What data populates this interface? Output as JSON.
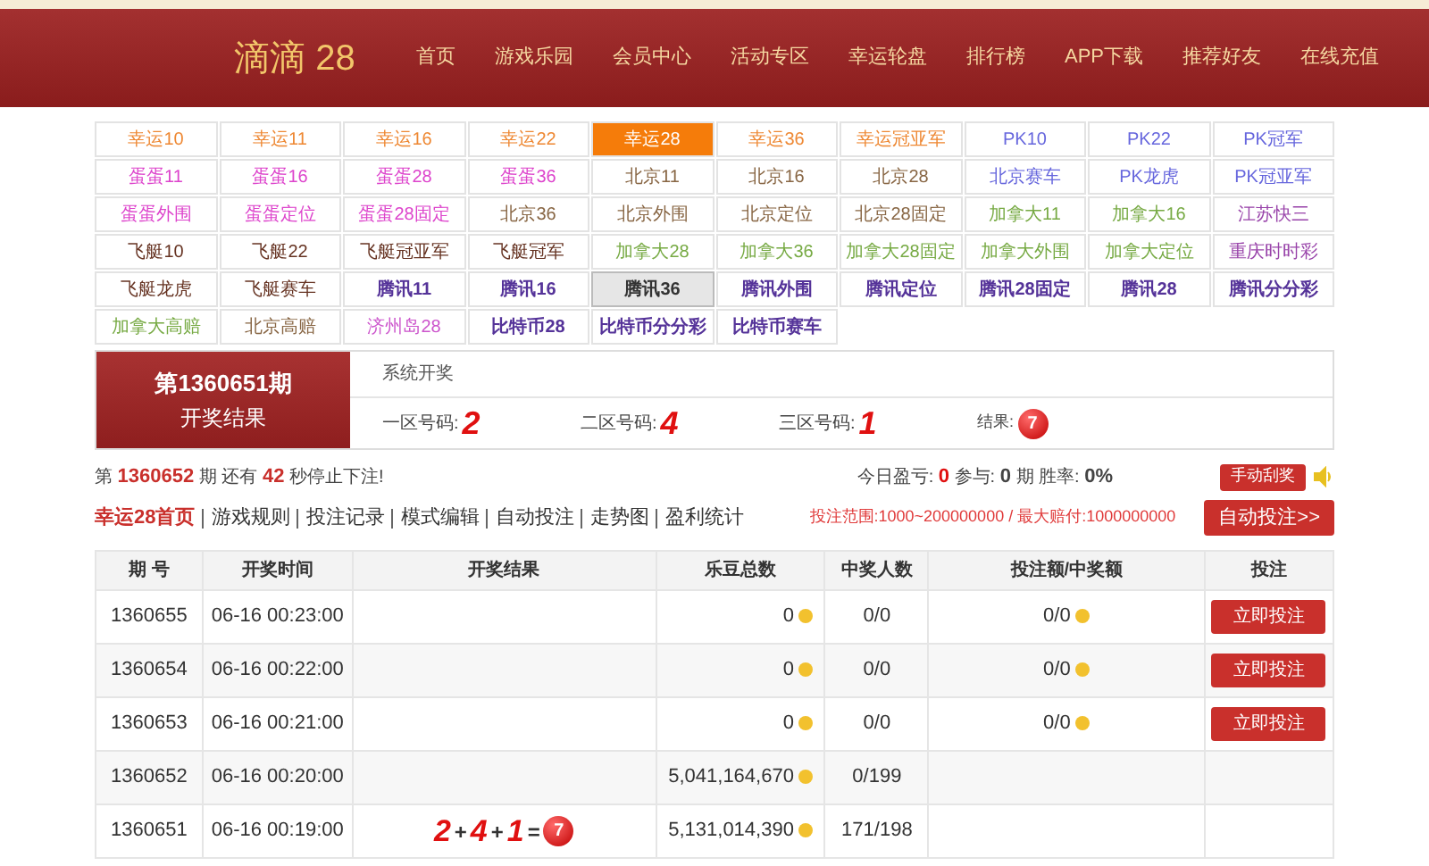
{
  "header": {
    "logo": "滴滴 28",
    "nav": [
      "首页",
      "游戏乐园",
      "会员中心",
      "活动专区",
      "幸运轮盘",
      "排行榜",
      "APP下载",
      "推荐好友",
      "在线充值"
    ]
  },
  "games": [
    {
      "label": "幸运10",
      "color": "#ee8833",
      "bold": false,
      "selected": false,
      "highlighted": false
    },
    {
      "label": "幸运11",
      "color": "#ee8833",
      "bold": false,
      "selected": false,
      "highlighted": false
    },
    {
      "label": "幸运16",
      "color": "#ee8833",
      "bold": false,
      "selected": false,
      "highlighted": false
    },
    {
      "label": "幸运22",
      "color": "#ee8833",
      "bold": false,
      "selected": false,
      "highlighted": false
    },
    {
      "label": "幸运28",
      "bold": false,
      "selected": true,
      "highlighted": false
    },
    {
      "label": "幸运36",
      "color": "#ee8833",
      "bold": false,
      "selected": false,
      "highlighted": false
    },
    {
      "label": "幸运冠亚军",
      "color": "#ee8833",
      "bold": false,
      "selected": false,
      "highlighted": false
    },
    {
      "label": "PK10",
      "color": "#6666dd",
      "bold": false,
      "selected": false,
      "highlighted": false
    },
    {
      "label": "PK22",
      "color": "#6666dd",
      "bold": false,
      "selected": false,
      "highlighted": false
    },
    {
      "label": "PK冠军",
      "color": "#6666dd",
      "bold": false,
      "selected": false,
      "highlighted": false
    },
    {
      "label": "蛋蛋11",
      "color": "#dd44cc",
      "bold": false,
      "selected": false,
      "highlighted": false
    },
    {
      "label": "蛋蛋16",
      "color": "#dd44cc",
      "bold": false,
      "selected": false,
      "highlighted": false
    },
    {
      "label": "蛋蛋28",
      "color": "#dd44cc",
      "bold": false,
      "selected": false,
      "highlighted": false
    },
    {
      "label": "蛋蛋36",
      "color": "#dd44cc",
      "bold": false,
      "selected": false,
      "highlighted": false
    },
    {
      "label": "北京11",
      "color": "#886644",
      "bold": false,
      "selected": false,
      "highlighted": false
    },
    {
      "label": "北京16",
      "color": "#886644",
      "bold": false,
      "selected": false,
      "highlighted": false
    },
    {
      "label": "北京28",
      "color": "#886644",
      "bold": false,
      "selected": false,
      "highlighted": false
    },
    {
      "label": "北京赛车",
      "color": "#6666dd",
      "bold": false,
      "selected": false,
      "highlighted": false
    },
    {
      "label": "PK龙虎",
      "color": "#6666dd",
      "bold": false,
      "selected": false,
      "highlighted": false
    },
    {
      "label": "PK冠亚军",
      "color": "#6666dd",
      "bold": false,
      "selected": false,
      "highlighted": false
    },
    {
      "label": "蛋蛋外围",
      "color": "#dd44cc",
      "bold": false,
      "selected": false,
      "highlighted": false
    },
    {
      "label": "蛋蛋定位",
      "color": "#dd44cc",
      "bold": false,
      "selected": false,
      "highlighted": false
    },
    {
      "label": "蛋蛋28固定",
      "color": "#dd44cc",
      "bold": false,
      "selected": false,
      "highlighted": false
    },
    {
      "label": "北京36",
      "color": "#886644",
      "bold": false,
      "selected": false,
      "highlighted": false
    },
    {
      "label": "北京外围",
      "color": "#886644",
      "bold": false,
      "selected": false,
      "highlighted": false
    },
    {
      "label": "北京定位",
      "color": "#886644",
      "bold": false,
      "selected": false,
      "highlighted": false
    },
    {
      "label": "北京28固定",
      "color": "#886644",
      "bold": false,
      "selected": false,
      "highlighted": false
    },
    {
      "label": "加拿大11",
      "color": "#77aa44",
      "bold": false,
      "selected": false,
      "highlighted": false
    },
    {
      "label": "加拿大16",
      "color": "#77aa44",
      "bold": false,
      "selected": false,
      "highlighted": false
    },
    {
      "label": "江苏快三",
      "color": "#9944aa",
      "bold": false,
      "selected": false,
      "highlighted": false
    },
    {
      "label": "飞艇10",
      "color": "#663322",
      "bold": false,
      "selected": false,
      "highlighted": false
    },
    {
      "label": "飞艇22",
      "color": "#663322",
      "bold": false,
      "selected": false,
      "highlighted": false
    },
    {
      "label": "飞艇冠亚军",
      "color": "#663322",
      "bold": false,
      "selected": false,
      "highlighted": false
    },
    {
      "label": "飞艇冠军",
      "color": "#663322",
      "bold": false,
      "selected": false,
      "highlighted": false
    },
    {
      "label": "加拿大28",
      "color": "#77aa44",
      "bold": false,
      "selected": false,
      "highlighted": false
    },
    {
      "label": "加拿大36",
      "color": "#77aa44",
      "bold": false,
      "selected": false,
      "highlighted": false
    },
    {
      "label": "加拿大28固定",
      "color": "#77aa44",
      "bold": false,
      "selected": false,
      "highlighted": false
    },
    {
      "label": "加拿大外围",
      "color": "#77aa44",
      "bold": false,
      "selected": false,
      "highlighted": false
    },
    {
      "label": "加拿大定位",
      "color": "#77aa44",
      "bold": false,
      "selected": false,
      "highlighted": false
    },
    {
      "label": "重庆时时彩",
      "color": "#9944aa",
      "bold": false,
      "selected": false,
      "highlighted": false
    },
    {
      "label": "飞艇龙虎",
      "color": "#663322",
      "bold": false,
      "selected": false,
      "highlighted": false
    },
    {
      "label": "飞艇赛车",
      "color": "#663322",
      "bold": false,
      "selected": false,
      "highlighted": false
    },
    {
      "label": "腾讯11",
      "color": "#553399",
      "bold": true,
      "selected": false,
      "highlighted": false
    },
    {
      "label": "腾讯16",
      "color": "#553399",
      "bold": true,
      "selected": false,
      "highlighted": false
    },
    {
      "label": "腾讯36",
      "color": "#333333",
      "bold": true,
      "selected": false,
      "highlighted": true
    },
    {
      "label": "腾讯外围",
      "color": "#553399",
      "bold": true,
      "selected": false,
      "highlighted": false
    },
    {
      "label": "腾讯定位",
      "color": "#553399",
      "bold": true,
      "selected": false,
      "highlighted": false
    },
    {
      "label": "腾讯28固定",
      "color": "#553399",
      "bold": true,
      "selected": false,
      "highlighted": false
    },
    {
      "label": "腾讯28",
      "color": "#553399",
      "bold": true,
      "selected": false,
      "highlighted": false
    },
    {
      "label": "腾讯分分彩",
      "color": "#553399",
      "bold": true,
      "selected": false,
      "highlighted": false
    },
    {
      "label": "加拿大高赔",
      "color": "#77aa44",
      "bold": false,
      "selected": false,
      "highlighted": false
    },
    {
      "label": "北京高赔",
      "color": "#886644",
      "bold": false,
      "selected": false,
      "highlighted": false
    },
    {
      "label": "济州岛28",
      "color": "#cc55cc",
      "bold": false,
      "selected": false,
      "highlighted": false
    },
    {
      "label": "比特币28",
      "color": "#553399",
      "bold": true,
      "selected": false,
      "highlighted": false
    },
    {
      "label": "比特币分分彩",
      "color": "#553399",
      "bold": true,
      "selected": false,
      "highlighted": false
    },
    {
      "label": "比特币赛车",
      "color": "#553399",
      "bold": true,
      "selected": false,
      "highlighted": false
    }
  ],
  "result": {
    "issue": "第1360651期",
    "caption": "开奖结果",
    "mode": "系统开奖",
    "zones": [
      {
        "label": "一区号码:",
        "value": "2"
      },
      {
        "label": "二区号码:",
        "value": "4"
      },
      {
        "label": "三区号码:",
        "value": "1"
      }
    ],
    "total_label": "结果:",
    "total": "7"
  },
  "status": {
    "prefix": "第",
    "issue": "1360652",
    "mid": "期 还有",
    "seconds": "42",
    "suffix": "秒停止下注!",
    "profit_label": "今日盈亏:",
    "profit": "0",
    "join_label": "参与:",
    "join": "0",
    "join_unit": "期 胜率:",
    "rate": "0%",
    "manual_button": "手动刮奖"
  },
  "links": [
    "幸运28首页",
    "游戏规则",
    "投注记录",
    "模式编辑",
    "自动投注",
    "走势图",
    "盈利统计"
  ],
  "bet_range": "投注范围:1000~200000000 / 最大赔付:1000000000",
  "auto_button": "自动投注>>",
  "table": {
    "columns": [
      "期 号",
      "开奖时间",
      "开奖结果",
      "乐豆总数",
      "中奖人数",
      "投注额/中奖额",
      "投注"
    ],
    "rows": [
      {
        "issue": "1360655",
        "time": "06-16 00:23:00",
        "beans": "0",
        "winners": "0/0",
        "bet": "0/0",
        "button": "立即投注"
      },
      {
        "issue": "1360654",
        "time": "06-16 00:22:00",
        "beans": "0",
        "winners": "0/0",
        "bet": "0/0",
        "button": "立即投注"
      },
      {
        "issue": "1360653",
        "time": "06-16 00:21:00",
        "beans": "0",
        "winners": "0/0",
        "bet": "0/0",
        "button": "立即投注"
      },
      {
        "issue": "1360652",
        "time": "06-16 00:20:00",
        "beans": "5,041,164,670",
        "winners": "0/199"
      },
      {
        "issue": "1360651",
        "time": "06-16 00:19:00",
        "result": {
          "numbers": [
            "2",
            "4",
            "1"
          ],
          "plus": "+",
          "equals": "=",
          "total": "7"
        },
        "beans": "5,131,014,390",
        "winners": "171/198"
      }
    ]
  }
}
